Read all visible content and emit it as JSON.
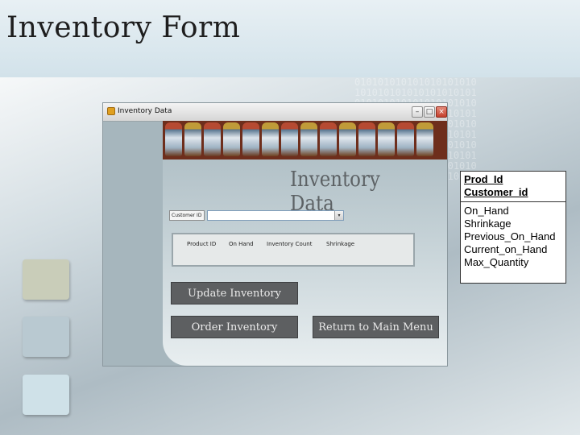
{
  "slide": {
    "title": "Inventory Form",
    "binary_pattern": "010101010101010101010\n101010101010101010101\n010101010101010101010\n101010101010101010101\n010101010101010101010\n101010101010101010101\n010101010101010101010\n101010101010101010101\n010101010101010101010\n101010101010101010101"
  },
  "window": {
    "title": "Inventory Data",
    "heading": "Inventory Data",
    "min_label": "–",
    "max_label": "□",
    "close_label": "×",
    "customer_label": "Customer ID",
    "customer_value": "",
    "select_arrow": "▾",
    "columns": [
      "Product ID",
      "On Hand",
      "Inventory Count",
      "Shrinkage"
    ],
    "buttons": {
      "update": "Update Inventory",
      "order": "Order Inventory",
      "return": "Return to Main Menu"
    }
  },
  "entity": {
    "keys": [
      "Prod_Id",
      "Customer_id"
    ],
    "attributes": [
      "On_Hand",
      "Shrinkage",
      "Previous_On_Hand",
      "Current_on_Hand",
      "Max_Quantity"
    ]
  },
  "colors": {
    "button_bg": "#5d5f61",
    "window_bg": "#a6b6bd",
    "banner_bg": "#6e2e1c"
  }
}
